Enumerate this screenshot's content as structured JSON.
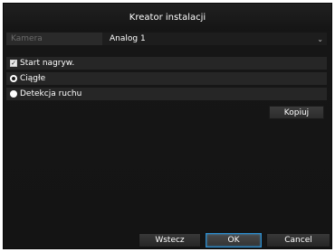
{
  "dialog": {
    "title": "Kreator instalacji"
  },
  "camera": {
    "label": "Kamera",
    "value": "Analog 1"
  },
  "options": {
    "start_recording": {
      "label": "Start nagryw.",
      "checked": true
    },
    "continuous": {
      "label": "Ciągłe",
      "selected": true
    },
    "motion": {
      "label": "Detekcja ruchu",
      "selected": false
    }
  },
  "buttons": {
    "copy": "Kopiuj",
    "back": "Wstecz",
    "ok": "OK",
    "cancel": "Cancel"
  },
  "colors": {
    "background": "#141414",
    "row": "#262626",
    "focus_border": "#2a8ccf"
  }
}
